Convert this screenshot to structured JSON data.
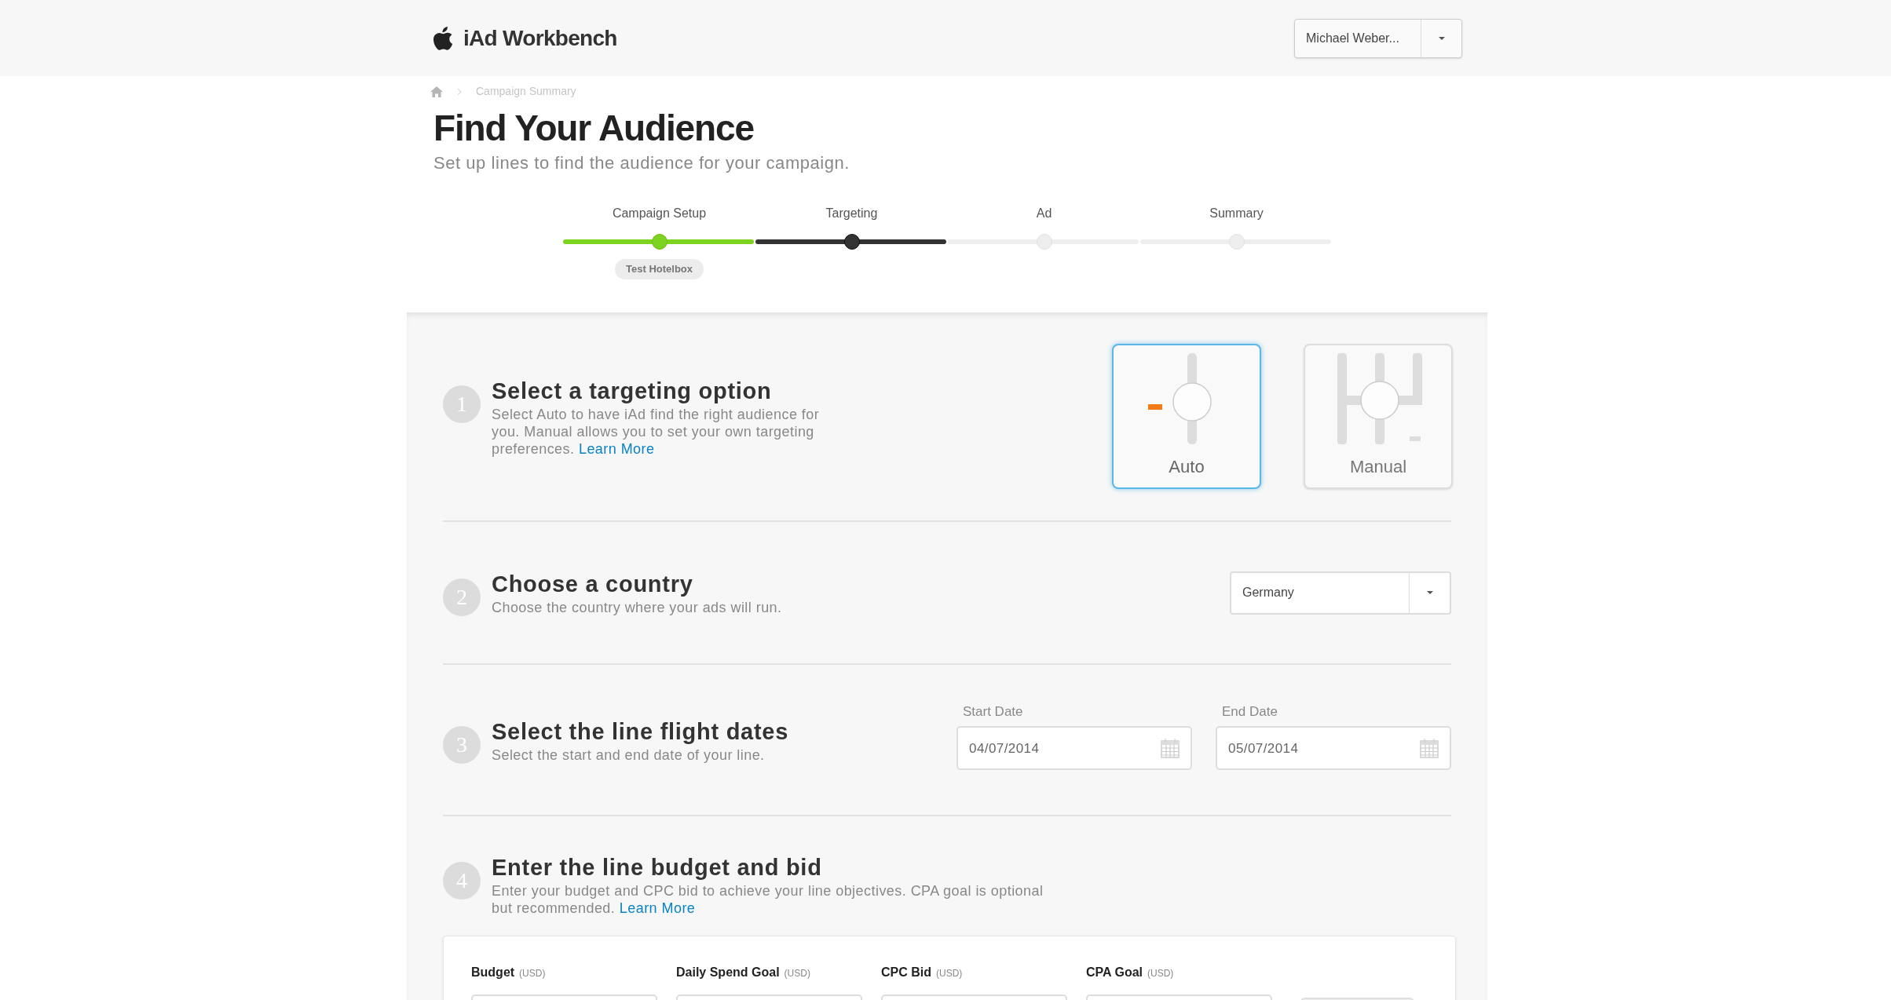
{
  "header": {
    "logo_text": "iAd Workbench",
    "user_menu": "Michael Weber..."
  },
  "breadcrumb": {
    "current": "Campaign Summary"
  },
  "page": {
    "title": "Find Your Audience",
    "subtitle": "Set up lines to find the audience for your campaign."
  },
  "steps": [
    {
      "label": "Campaign Setup",
      "done": true,
      "current": false,
      "badge": "Test Hotelbox"
    },
    {
      "label": "Targeting",
      "done": false,
      "current": true
    },
    {
      "label": "Ad",
      "done": false,
      "current": false
    },
    {
      "label": "Summary",
      "done": false,
      "current": false
    }
  ],
  "sections": [
    {
      "kind": "targeting",
      "number": "1",
      "title": "Select a targeting option",
      "description": "Select Auto to have iAd find the right audience for you. Manual allows you to set your own targeting preferences.",
      "link": "Learn More",
      "options": [
        {
          "label": "Auto",
          "selected": true
        },
        {
          "label": "Manual",
          "selected": false
        }
      ]
    },
    {
      "kind": "country",
      "number": "2",
      "title": "Choose a country",
      "description": "Choose the country where your ads will run.",
      "value": "Germany"
    },
    {
      "kind": "dates",
      "number": "3",
      "title": "Select the line flight dates",
      "description": "Select the start and end date of your line.",
      "fields": [
        {
          "label": "Start Date",
          "value": "04/07/2014"
        },
        {
          "label": "End Date",
          "value": "05/07/2014"
        }
      ]
    },
    {
      "kind": "budget",
      "number": "4",
      "title": "Enter the line budget and bid",
      "description": "Enter your budget and CPC bid to achieve your line objectives. CPA goal is optional but recommended.",
      "link": "Learn More",
      "fields": [
        {
          "label": "Budget",
          "unit": "(USD)"
        },
        {
          "label": "Daily Spend Goal",
          "unit": "(USD)"
        },
        {
          "label": "CPC Bid",
          "unit": "(USD)"
        },
        {
          "label": "CPA Goal",
          "unit": "(USD)"
        }
      ]
    }
  ]
}
